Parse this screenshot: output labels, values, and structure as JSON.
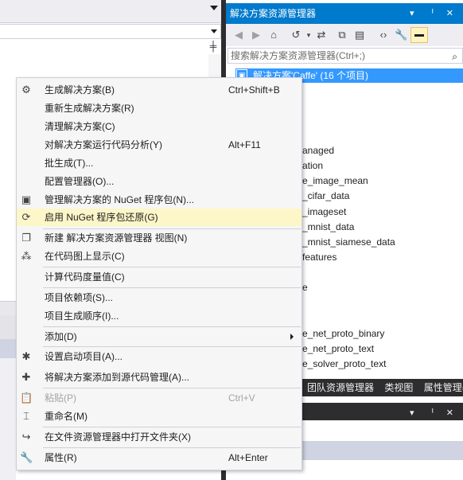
{
  "solution_explorer": {
    "title": "解决方案资源管理器",
    "title_buttons": "▾ ᅵ ✕",
    "search_placeholder": "搜索解决方案资源管理器(Ctrl+;)",
    "root_label": "解决方案'Caffe' (16 个项目)",
    "tree_items": [
      "anaged",
      "ation",
      "e_image_mean",
      "_cifar_data",
      "_imageset",
      "_mnist_data",
      "_mnist_siamese_data",
      "features",
      "e",
      "e_net_proto_binary",
      "e_net_proto_text",
      "e_solver_proto_text"
    ],
    "bottom_tabs": [
      "团队资源管理器",
      "类视图",
      "属性管理器"
    ]
  },
  "context_menu": {
    "items": [
      {
        "label": "生成解决方案(B)",
        "shortcut": "Ctrl+Shift+B",
        "icon": "build-solution-icon",
        "glyph": "⚙"
      },
      {
        "label": "重新生成解决方案(R)",
        "shortcut": "",
        "icon": "",
        "glyph": ""
      },
      {
        "label": "清理解决方案(C)",
        "shortcut": "",
        "icon": "",
        "glyph": ""
      },
      {
        "label": "对解决方案运行代码分析(Y)",
        "shortcut": "Alt+F11",
        "icon": "",
        "glyph": ""
      },
      {
        "label": "批生成(T)...",
        "shortcut": "",
        "icon": "",
        "glyph": ""
      },
      {
        "label": "配置管理器(O)...",
        "shortcut": "",
        "icon": "",
        "glyph": ""
      },
      {
        "label": "管理解决方案的 NuGet 程序包(N)...",
        "shortcut": "",
        "icon": "nuget-package-icon",
        "glyph": "▣"
      },
      {
        "label": "启用 NuGet 程序包还原(G)",
        "shortcut": "",
        "icon": "nuget-restore-icon",
        "glyph": "⟳"
      },
      {
        "label": "新建 解决方案资源管理器 视图(N)",
        "shortcut": "",
        "icon": "new-view-icon",
        "glyph": "❐"
      },
      {
        "label": "在代码图上显示(C)",
        "shortcut": "",
        "icon": "code-map-icon",
        "glyph": "⁂"
      },
      {
        "label": "计算代码度量值(C)",
        "shortcut": "",
        "icon": "",
        "glyph": ""
      },
      {
        "label": "项目依赖项(S)...",
        "shortcut": "",
        "icon": "",
        "glyph": ""
      },
      {
        "label": "项目生成顺序(I)...",
        "shortcut": "",
        "icon": "",
        "glyph": ""
      },
      {
        "label": "添加(D)",
        "shortcut": "",
        "icon": "",
        "glyph": ""
      },
      {
        "label": "设置启动项目(A)...",
        "shortcut": "",
        "icon": "gear-icon",
        "glyph": "✱"
      },
      {
        "label": "将解决方案添加到源代码管理(A)...",
        "shortcut": "",
        "icon": "source-control-icon",
        "glyph": "✚"
      },
      {
        "label": "粘贴(P)",
        "shortcut": "Ctrl+V",
        "icon": "paste-icon",
        "glyph": "📋"
      },
      {
        "label": "重命名(M)",
        "shortcut": "",
        "icon": "rename-icon",
        "glyph": "⌶"
      },
      {
        "label": "在文件资源管理器中打开文件夹(X)",
        "shortcut": "",
        "icon": "open-folder-icon",
        "glyph": "↪"
      },
      {
        "label": "属性(R)",
        "shortcut": "Alt+Enter",
        "icon": "wrench-icon",
        "glyph": "🔧"
      }
    ]
  },
  "colors": {
    "accent": "#007acc",
    "selection": "#3399ff",
    "menu_highlight": "#fdf6c9",
    "dark_tab": "#2d2d30"
  }
}
